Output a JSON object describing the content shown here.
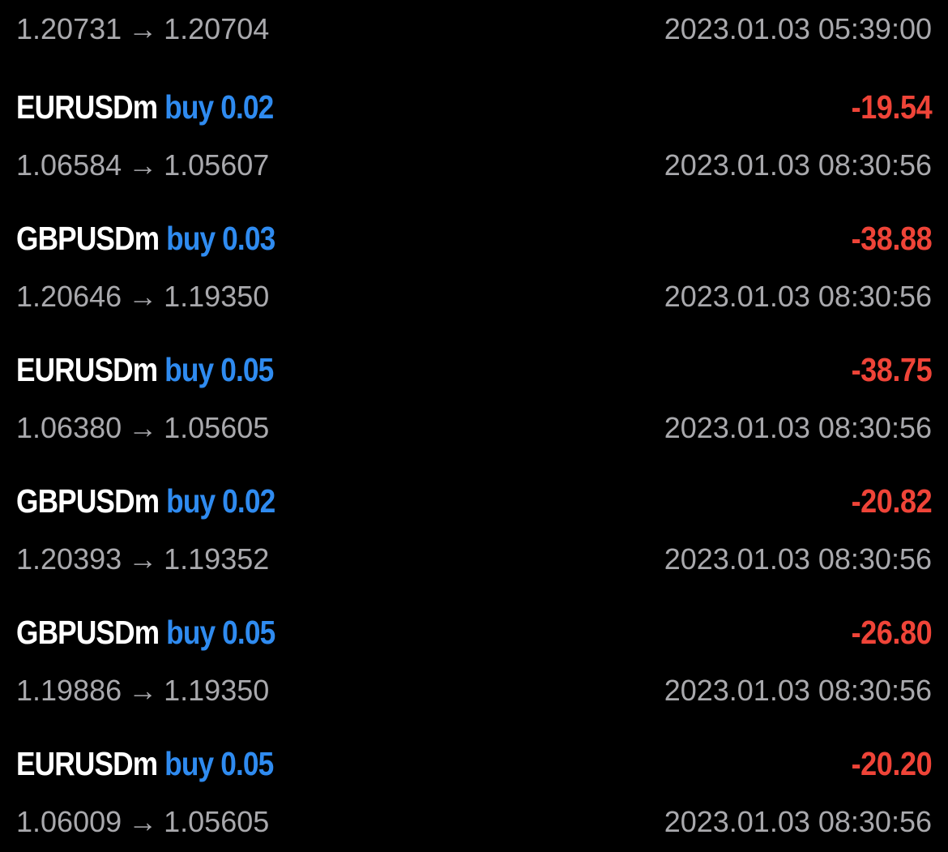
{
  "partial_row": {
    "open_price": "1.20731",
    "close_price": "1.20704",
    "time": "2023.01.03 05:39:00"
  },
  "arrow": "→",
  "trades": [
    {
      "symbol": "EURUSDm",
      "order": "buy 0.02",
      "profit": "-19.54",
      "open_price": "1.06584",
      "close_price": "1.05607",
      "time": "2023.01.03 08:30:56"
    },
    {
      "symbol": "GBPUSDm",
      "order": "buy 0.03",
      "profit": "-38.88",
      "open_price": "1.20646",
      "close_price": "1.19350",
      "time": "2023.01.03 08:30:56"
    },
    {
      "symbol": "EURUSDm",
      "order": "buy 0.05",
      "profit": "-38.75",
      "open_price": "1.06380",
      "close_price": "1.05605",
      "time": "2023.01.03 08:30:56"
    },
    {
      "symbol": "GBPUSDm",
      "order": "buy 0.02",
      "profit": "-20.82",
      "open_price": "1.20393",
      "close_price": "1.19352",
      "time": "2023.01.03 08:30:56"
    },
    {
      "symbol": "GBPUSDm",
      "order": "buy 0.05",
      "profit": "-26.80",
      "open_price": "1.19886",
      "close_price": "1.19350",
      "time": "2023.01.03 08:30:56"
    },
    {
      "symbol": "EURUSDm",
      "order": "buy 0.05",
      "profit": "-20.20",
      "open_price": "1.06009",
      "close_price": "1.05605",
      "time": "2023.01.03 08:30:56"
    }
  ],
  "colors": {
    "background": "#000000",
    "symbol": "#ffffff",
    "order": "#2f8bf0",
    "loss": "#ef4438",
    "secondary_text": "#a9a9ad"
  }
}
